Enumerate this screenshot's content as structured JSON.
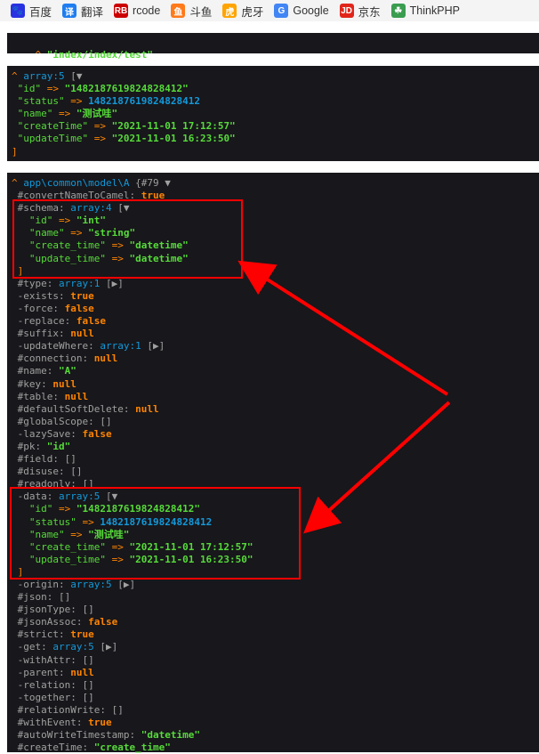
{
  "bookmarks": [
    {
      "label": "百度",
      "icon": "baidu-paw-icon",
      "glyph": "🐾",
      "color": "#2932e1"
    },
    {
      "label": "翻译",
      "icon": "translate-icon",
      "glyph": "译",
      "color": "#1f7ef0"
    },
    {
      "label": "rcode",
      "icon": "rb-icon",
      "glyph": "RB",
      "color": "#cc0000"
    },
    {
      "label": "斗鱼",
      "icon": "douyu-icon",
      "glyph": "鱼",
      "color": "#ff7a1a"
    },
    {
      "label": "虎牙",
      "icon": "huya-icon",
      "glyph": "虎",
      "color": "#ffa400"
    },
    {
      "label": "Google",
      "icon": "google-icon",
      "glyph": "G",
      "color": "#4285f4"
    },
    {
      "label": "京东",
      "icon": "jd-icon",
      "glyph": "JD",
      "color": "#e1251b"
    },
    {
      "label": "ThinkPHP",
      "icon": "thinkphp-icon",
      "glyph": "☘",
      "color": "#3a9d4f"
    }
  ],
  "route": {
    "caret": "^",
    "text": "\"index/index/test\""
  },
  "array_dump": {
    "header": "array:5",
    "toggle": "[▼",
    "items": [
      {
        "key": "\"id\"",
        "op": "=>",
        "value": "\"1482187619824828412\""
      },
      {
        "key": "\"status\"",
        "op": "=>",
        "value": "1482187619824828412"
      },
      {
        "key": "\"name\"",
        "op": "=>",
        "value": "\"测试哇\""
      },
      {
        "key": "\"createTime\"",
        "op": "=>",
        "value": "\"2021-11-01 17:12:57\""
      },
      {
        "key": "\"updateTime\"",
        "op": "=>",
        "value": "\"2021-11-01 16:23:50\""
      }
    ],
    "close": "]"
  },
  "object_dump": {
    "class": "app\\common\\model\\A",
    "id": "{#79",
    "toggle": "▼",
    "convertNameToCamel": {
      "name": "#convertNameToCamel",
      "value": "true"
    },
    "schema": {
      "name": "#schema",
      "header": "array:4",
      "toggle": "[▼",
      "items": [
        {
          "key": "\"id\"",
          "op": "=>",
          "value": "\"int\""
        },
        {
          "key": "\"name\"",
          "op": "=>",
          "value": "\"string\""
        },
        {
          "key": "\"create_time\"",
          "op": "=>",
          "value": "\"datetime\""
        },
        {
          "key": "\"update_time\"",
          "op": "=>",
          "value": "\"datetime\""
        }
      ],
      "close": "]"
    },
    "props_a": [
      {
        "name": "#type",
        "value": "array:1",
        "extra": "[▶]"
      },
      {
        "name": "-exists",
        "value": "true"
      },
      {
        "name": "-force",
        "value": "false"
      },
      {
        "name": "-replace",
        "value": "false"
      },
      {
        "name": "#suffix",
        "value": "null"
      },
      {
        "name": "-updateWhere",
        "value": "array:1",
        "extra": "[▶]"
      },
      {
        "name": "#connection",
        "value": "null"
      },
      {
        "name": "#name",
        "value": "\"A\""
      },
      {
        "name": "#key",
        "value": "null"
      },
      {
        "name": "#table",
        "value": "null"
      },
      {
        "name": "#defaultSoftDelete",
        "value": "null"
      },
      {
        "name": "#globalScope",
        "value": "[]"
      },
      {
        "name": "-lazySave",
        "value": "false"
      },
      {
        "name": "#pk",
        "value": "\"id\""
      },
      {
        "name": "#field",
        "value": "[]"
      },
      {
        "name": "#disuse",
        "value": "[]"
      },
      {
        "name": "#readonly",
        "value": "[]"
      }
    ],
    "data": {
      "name": "-data",
      "header": "array:5",
      "toggle": "[▼",
      "items": [
        {
          "key": "\"id\"",
          "op": "=>",
          "value": "\"1482187619824828412\""
        },
        {
          "key": "\"status\"",
          "op": "=>",
          "value": "1482187619824828412"
        },
        {
          "key": "\"name\"",
          "op": "=>",
          "value": "\"测试哇\""
        },
        {
          "key": "\"create_time\"",
          "op": "=>",
          "value": "\"2021-11-01 17:12:57\""
        },
        {
          "key": "\"update_time\"",
          "op": "=>",
          "value": "\"2021-11-01 16:23:50\""
        }
      ],
      "close": "]"
    },
    "props_b": [
      {
        "name": "-origin",
        "value": "array:5",
        "extra": "[▶]"
      },
      {
        "name": "#json",
        "value": "[]"
      },
      {
        "name": "#jsonType",
        "value": "[]"
      },
      {
        "name": "#jsonAssoc",
        "value": "false"
      },
      {
        "name": "#strict",
        "value": "true"
      },
      {
        "name": "-get",
        "value": "array:5",
        "extra": "[▶]"
      },
      {
        "name": "-withAttr",
        "value": "[]"
      },
      {
        "name": "-parent",
        "value": "null"
      },
      {
        "name": "-relation",
        "value": "[]"
      },
      {
        "name": "-together",
        "value": "[]"
      },
      {
        "name": "#relationWrite",
        "value": "[]"
      },
      {
        "name": "#withEvent",
        "value": "true"
      },
      {
        "name": "#autoWriteTimestamp",
        "value": "\"datetime\""
      },
      {
        "name": "#createTime",
        "value": "\"create_time\""
      }
    ]
  },
  "colors": {
    "panel_bg": "#18171B",
    "key": "#56DB3A",
    "arrow": "#FF8400",
    "number": "#1299DA",
    "default": "#A0A0A0",
    "annotation": "#FF0000"
  }
}
